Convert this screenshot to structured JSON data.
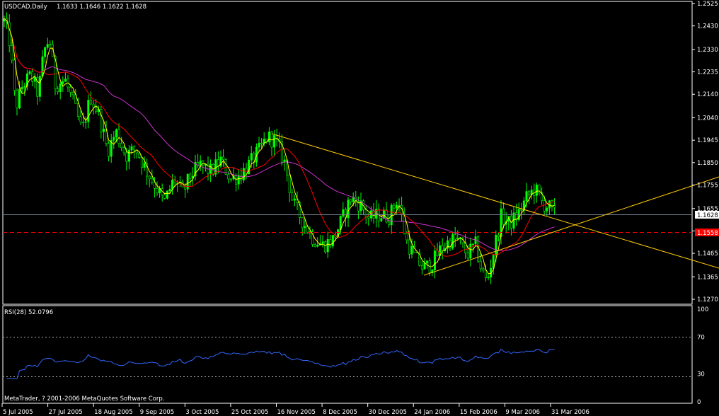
{
  "main_chart": {
    "symbol_label": "USDCAD,Daily",
    "ohlc_readout": "1.1633 1.1646 1.1622 1.1628",
    "current_price_label": "1.1628",
    "alert_price_label": "1.1558",
    "price_ticks": [
      "1.2525",
      "1.2430",
      "1.2330",
      "1.2235",
      "1.2140",
      "1.2040",
      "1.1945",
      "1.1850",
      "1.1755",
      "1.1655",
      "1.1560",
      "1.1465",
      "1.1365",
      "1.1270"
    ]
  },
  "rsi_panel": {
    "label": "RSI(28) 52.0796",
    "ticks": [
      "100",
      "70",
      "30",
      "0"
    ]
  },
  "copyright": "MetaTrader, ? 2001-2006 MetaQuotes Software Corp.",
  "date_ticks": [
    "5 Jul 2005",
    "27 Jul 2005",
    "18 Aug 2005",
    "9 Sep 2005",
    "3 Oct 2005",
    "25 Oct 2005",
    "16 Nov 2005",
    "8 Dec 2005",
    "30 Dec 2005",
    "24 Jan 2006",
    "15 Feb 2006",
    "9 Mar 2006",
    "31 Mar 2006"
  ],
  "colors": {
    "background": "#000000",
    "frame": "#ffffff",
    "candle": "#00ff00",
    "ma_fast": "#ffff00",
    "ma_mid": "#ff0000",
    "ma_slow": "#cc33cc",
    "trendline": "#ffcc00",
    "rsi_line": "#3366ff",
    "alert_line": "#ff0000",
    "current_line": "#708090"
  },
  "chart_data": {
    "type": "candlestick",
    "instrument": "USDCAD",
    "timeframe": "Daily",
    "y_range": [
      1.2525,
      1.127
    ],
    "x_range": [
      "5 Jul 2005",
      "31 Mar 2006"
    ],
    "last_close": 1.1628,
    "alert_level": 1.1558,
    "price_path_approx": [
      {
        "date": "5 Jul 2005",
        "close": 1.245
      },
      {
        "date": "15 Jul 2005",
        "close": 1.215
      },
      {
        "date": "27 Jul 2005",
        "close": 1.225
      },
      {
        "date": "18 Aug 2005",
        "close": 1.205
      },
      {
        "date": "9 Sep 2005",
        "close": 1.178
      },
      {
        "date": "3 Oct 2005",
        "close": 1.18
      },
      {
        "date": "25 Oct 2005",
        "close": 1.185
      },
      {
        "date": "10 Nov 2005",
        "close": 1.193
      },
      {
        "date": "8 Dec 2005",
        "close": 1.153
      },
      {
        "date": "30 Dec 2005",
        "close": 1.163
      },
      {
        "date": "24 Jan 2006",
        "close": 1.143
      },
      {
        "date": "15 Feb 2006",
        "close": 1.15
      },
      {
        "date": "22 Feb 2006",
        "close": 1.135
      },
      {
        "date": "9 Mar 2006",
        "close": 1.158
      },
      {
        "date": "31 Mar 2006",
        "close": 1.1628
      }
    ],
    "rsi": {
      "period": 28,
      "last": 52.0796,
      "levels": [
        70,
        30
      ],
      "range": [
        0,
        100
      ]
    }
  }
}
